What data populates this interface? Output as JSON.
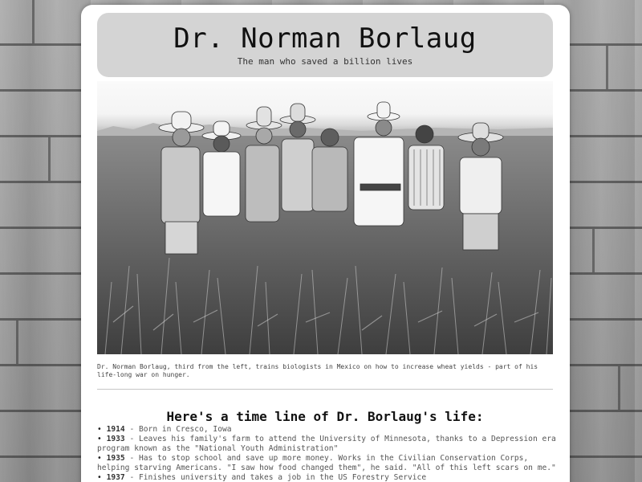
{
  "page": {
    "title": "Dr. Norman Borlaug",
    "subtitle": "The man who saved a billion lives"
  },
  "photo": {
    "caption": "Dr. Norman Borlaug, third from the left, trains biologists in Mexico on how to increase wheat yields - part of his life-long war on hunger."
  },
  "timeline": {
    "heading": "Here's a time line of Dr. Borlaug's life:",
    "bullet": "•",
    "separator": " - ",
    "events": [
      {
        "year": "1914",
        "text": "Born in Cresco, Iowa"
      },
      {
        "year": "1933",
        "text": "Leaves his family's farm to attend the University of Minnesota, thanks to a Depression era program known as the \"National Youth Administration\""
      },
      {
        "year": "1935",
        "text": "Has to stop school and save up more money. Works in the Civilian Conservation Corps, helping starving Americans. \"I saw how food changed them\", he said. \"All of this left scars on me.\""
      },
      {
        "year": "1937",
        "text": "Finishes university and takes a job in the US Forestry Service"
      }
    ]
  },
  "colors": {
    "card": "#ffffff",
    "header": "#d4d4d4",
    "background": "#9a9a9a"
  }
}
